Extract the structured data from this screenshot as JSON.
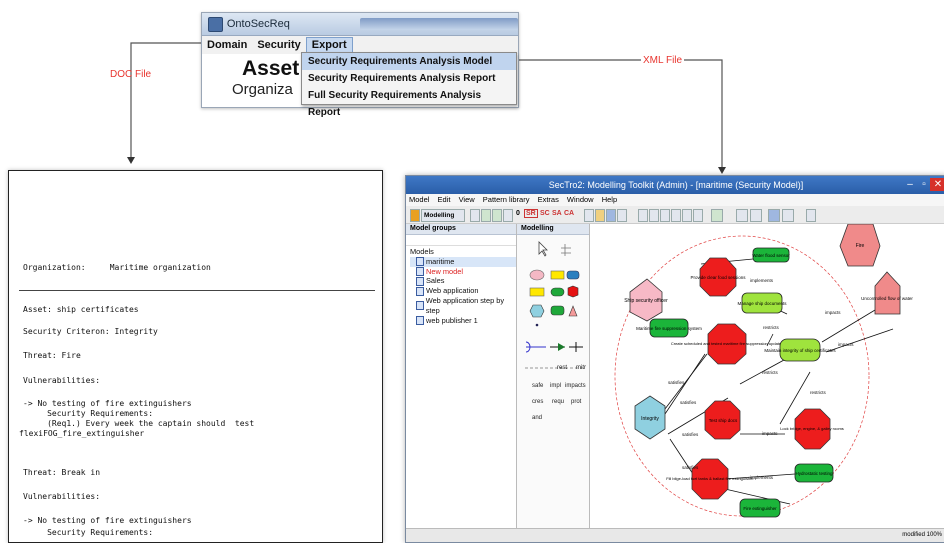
{
  "top_window": {
    "title": "OntoSecReq",
    "menus": [
      "Domain",
      "Security",
      "Export"
    ],
    "active_menu": "Export",
    "heading": "Asset a",
    "subheading": "Organiza",
    "export_items": [
      "Security Requirements Analysis Model",
      "Security Requirements Analysis Report",
      "Full Security Requirements Analysis Report"
    ]
  },
  "connectors": {
    "doc_label": "DOC File",
    "xml_label": "XML File"
  },
  "document": {
    "lines": [
      "Organization:     Maritime organization",
      "Asset: ship certificates",
      "Security Criteron: Integrity",
      "Threat: Fire",
      "Vulnerabilities:",
      "-> No testing of fire extinguishers",
      "     Security Requirements:",
      "     (Req1.) Every week the captain should  test",
      "flexiFOG_fire_extinguisher",
      "Threat: Break in",
      "Vulnerabilities:",
      "-> No testing of fire extinguishers",
      "     Security Requirements:"
    ]
  },
  "toolkit": {
    "title": "SecTro2: Modelling Toolkit (Admin) - [maritime (Security Model)]",
    "menu": [
      "Model",
      "Edit",
      "View",
      "Pattern library",
      "Extras",
      "Window",
      "Help"
    ],
    "mode_label": "Modelling",
    "toolbar_text": [
      "0",
      "SR",
      "SC",
      "SA",
      "CA"
    ],
    "panels": {
      "model_groups": "Model groups",
      "modelling": "Modelling"
    },
    "tree_root": "Models",
    "tree_items": [
      "maritime",
      "New model",
      "Sales",
      "Web application",
      "Web application step by step",
      "web publisher 1"
    ],
    "palette_labels": [
      "rest",
      "mitr",
      "safe",
      "impl",
      "impacts",
      "cres",
      "requ",
      "prot",
      "and"
    ],
    "status": "modified   100%",
    "diagram": {
      "nodes": [
        "Ship security officer",
        "Provide clear food sessions",
        "Water flood sensor",
        "Manage ship documents",
        "Maritime fire suppression system",
        "Create scheduled and tested maritime fire suppression updates",
        "Maintain integrity of ship certificates",
        "Fire",
        "Uncontrolled flow of water",
        "Integrity",
        "Test ship docs",
        "Lock bridge, engine, & galley rooms",
        "Fill bilge-load fuel tanks & ballast fire extinguisher",
        "Hydrostatic testing",
        "Fire extinguisher"
      ],
      "links": [
        "implements",
        "restricts",
        "impacts",
        "satisfies",
        "impacts",
        "satisfies",
        "restricts",
        "restricts",
        "satisfies",
        "impacts",
        "satisfies",
        "implements"
      ]
    }
  }
}
